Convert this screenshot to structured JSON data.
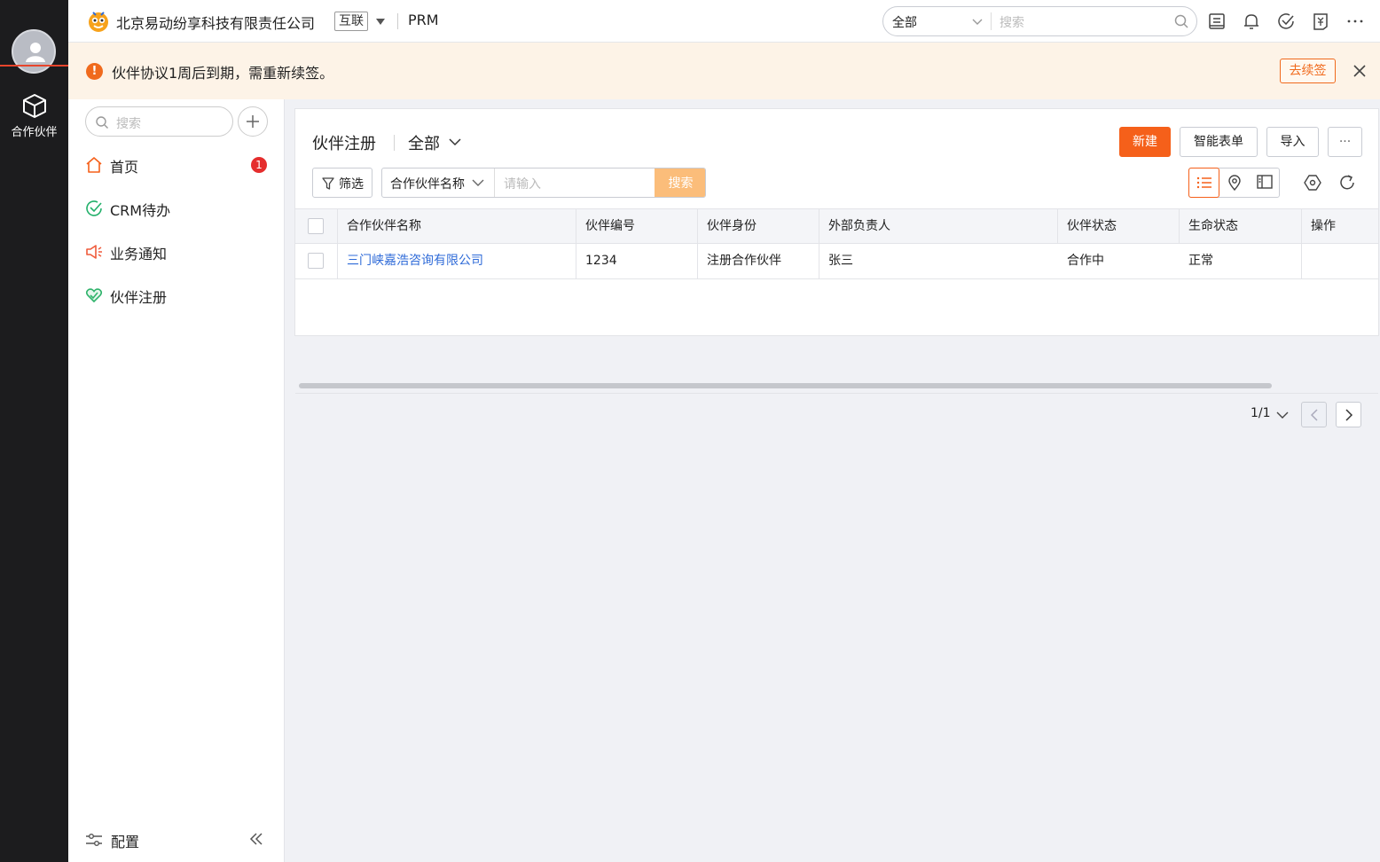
{
  "rail": {
    "app_label": "合作伙伴"
  },
  "topbar": {
    "company": "北京易动纷享科技有限责任公司",
    "company_tag": "互联",
    "app_name": "PRM",
    "search_scope": "全部",
    "search_placeholder": "搜索"
  },
  "notice": {
    "message": "伙伴协议1周后到期，需重新续签。",
    "action": "去续签"
  },
  "sidebar": {
    "search_placeholder": "搜索",
    "items": [
      {
        "label": "首页",
        "badge": "1"
      },
      {
        "label": "CRM待办"
      },
      {
        "label": "业务通知"
      },
      {
        "label": "伙伴注册"
      }
    ],
    "footer": "配置"
  },
  "main": {
    "title": "伙伴注册",
    "view": "全部",
    "buttons": {
      "new": "新建",
      "smart_form": "智能表单",
      "import": "导入",
      "more": "···"
    },
    "filter_label": "筛选",
    "search_field": "合作伙伴名称",
    "search_placeholder": "请输入",
    "search_button": "搜索",
    "columns": [
      "合作伙伴名称",
      "伙伴编号",
      "伙伴身份",
      "外部负责人",
      "伙伴状态",
      "生命状态",
      "操作"
    ],
    "rows": [
      [
        "三门峡嘉浩咨询有限公司",
        "1234",
        "注册合作伙伴",
        "张三",
        "合作中",
        "正常",
        ""
      ]
    ],
    "pager": "1/1"
  },
  "colors": {
    "accent": "#f5601a",
    "link": "#2f6bd8",
    "rail_bg": "#1c1c1e",
    "notice_bg": "#fdf3e7",
    "badge": "#e52d2d"
  }
}
